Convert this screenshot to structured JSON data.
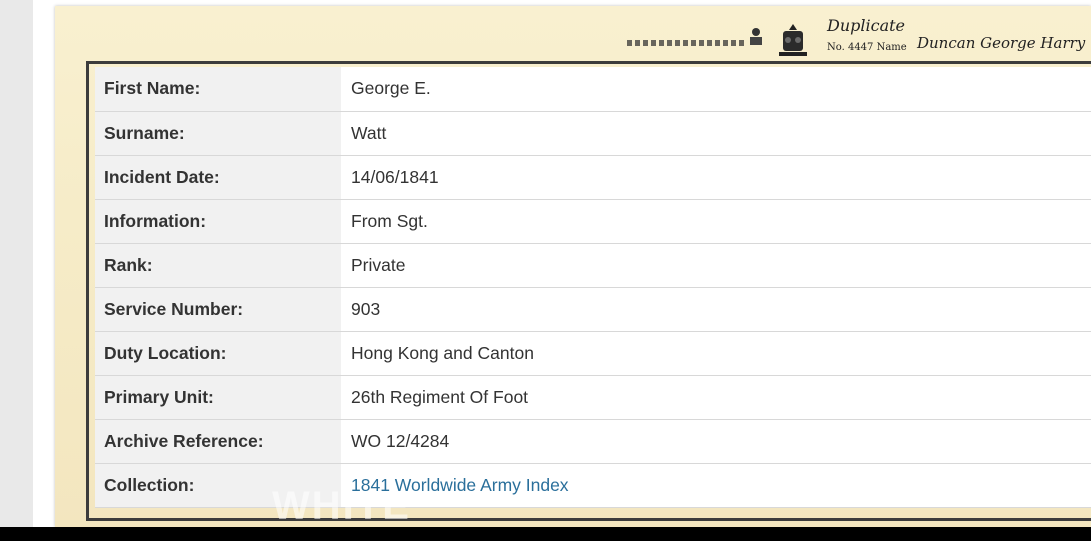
{
  "document": {
    "header": {
      "duplicate": "Duplicate",
      "no_name": "No. 4447  Name",
      "signature": "Duncan George Harry"
    }
  },
  "record": {
    "rows": [
      {
        "label": "First Name:",
        "value": "George E."
      },
      {
        "label": "Surname:",
        "value": "Watt"
      },
      {
        "label": "Incident Date:",
        "value": "14/06/1841"
      },
      {
        "label": "Information:",
        "value": "From Sgt."
      },
      {
        "label": "Rank:",
        "value": "Private"
      },
      {
        "label": "Service Number:",
        "value": "903"
      },
      {
        "label": "Duty Location:",
        "value": "Hong Kong and Canton"
      },
      {
        "label": "Primary Unit:",
        "value": "26th Regiment Of Foot"
      },
      {
        "label": "Archive Reference:",
        "value": "WO 12/4284"
      },
      {
        "label": "Collection:",
        "value": "1841 Worldwide Army Index"
      }
    ]
  },
  "watermark": "WHITE",
  "colors": {
    "paper": "#f6ecc8",
    "label_bg": "#f1f1f1",
    "link": "#2a6f9b",
    "frame": "#3c3c3c"
  }
}
